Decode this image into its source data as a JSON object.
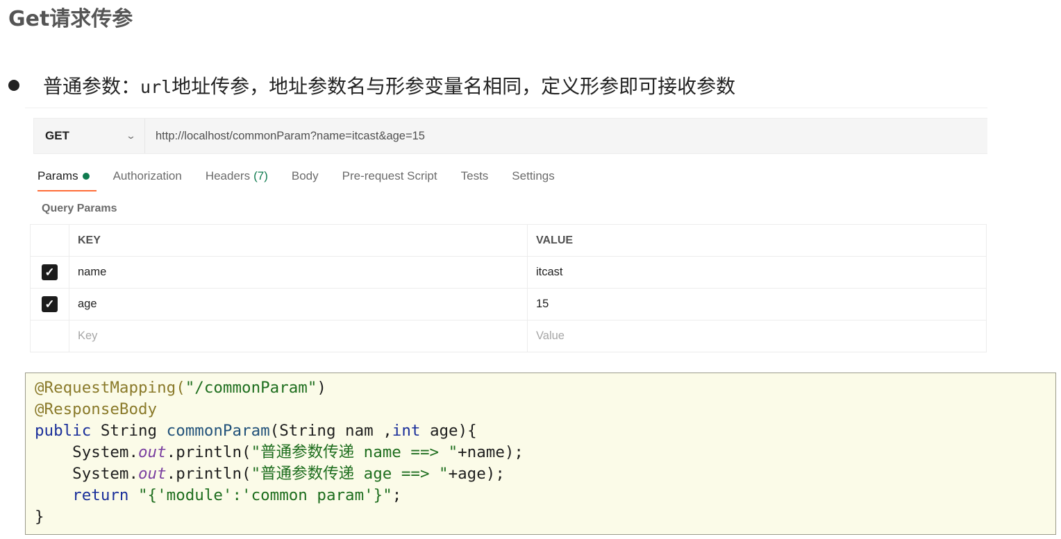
{
  "heading": "Get请求传参",
  "bullet": {
    "prefix": "普通参数：",
    "mono": "url",
    "suffix": "地址传参，地址参数名与形参变量名相同，定义形参即可接收参数"
  },
  "postman": {
    "method": "GET",
    "url": "http://localhost/commonParam?name=itcast&age=15",
    "tabs": {
      "params": "Params",
      "authorization": "Authorization",
      "headers": "Headers",
      "headers_count": "(7)",
      "body": "Body",
      "prerequest": "Pre-request Script",
      "tests": "Tests",
      "settings": "Settings"
    },
    "query_params_title": "Query Params",
    "columns": {
      "key": "KEY",
      "value": "VALUE"
    },
    "rows": [
      {
        "key": "name",
        "value": "itcast",
        "checked": true
      },
      {
        "key": "age",
        "value": "15",
        "checked": true
      }
    ],
    "placeholder": {
      "key": "Key",
      "value": "Value"
    }
  },
  "code": {
    "line1_ann": "@RequestMapping(",
    "line1_str": "\"/commonParam\"",
    "line1_end": ")",
    "line2_ann": "@ResponseBody",
    "line3_kw": "public",
    "line3_type": " String ",
    "line3_fn": "commonParam",
    "line3_a": "(String nam",
    "line3_b": " ,",
    "line3_kw2": "int",
    "line3_c": " age){",
    "line4_a": "    System.",
    "line4_out": "out",
    "line4_b": ".println(",
    "line4_str": "\"普通参数传递 name ==> \"",
    "line4_c": "+name);",
    "line5_a": "    System.",
    "line5_out": "out",
    "line5_b": ".println(",
    "line5_str": "\"普通参数传递 age ==> \"",
    "line5_c": "+age);",
    "line6_kw": "    return",
    "line6_str": " \"{'module':'common param'}\"",
    "line6_c": ";",
    "line7": "}"
  }
}
